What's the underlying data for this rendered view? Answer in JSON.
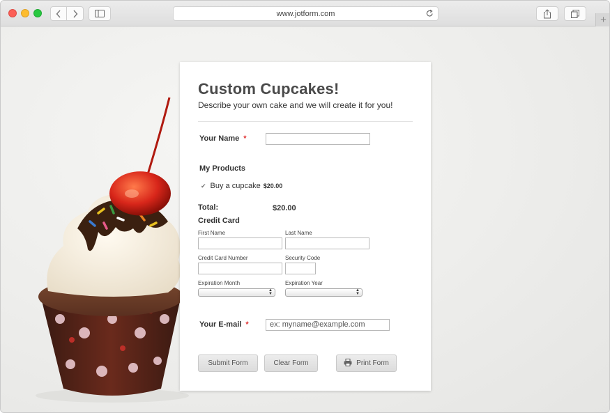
{
  "browser": {
    "url": "www.jotform.com",
    "new_tab_glyph": "+"
  },
  "form": {
    "title": "Custom Cupcakes!",
    "subtitle": "Describe your own cake and we will create it for you!",
    "name_label": "Your Name",
    "name_required": "*",
    "name_value": "",
    "products_label": "My Products",
    "product_item": "Buy a cupcake",
    "product_price": "$20.00",
    "product_checked": true,
    "total_label": "Total:",
    "total_value": "$20.00",
    "credit_card_label": "Credit Card",
    "first_name_label": "First Name",
    "last_name_label": "Last Name",
    "cc_number_label": "Credit Card Number",
    "security_code_label": "Security Code",
    "exp_month_label": "Expiration Month",
    "exp_year_label": "Expiration Year",
    "exp_month_value": "",
    "exp_year_value": "",
    "email_label": "Your E-mail",
    "email_required": "*",
    "email_placeholder": "ex: myname@example.com",
    "submit_label": "Submit Form",
    "clear_label": "Clear Form",
    "print_label": "Print Form"
  },
  "colors": {
    "required": "#e03333",
    "close": "#fc5f57",
    "minimize": "#fdbc2e",
    "maximize": "#28c840"
  },
  "icons": [
    "back-icon",
    "forward-icon",
    "sidebar-icon",
    "reload-icon",
    "share-icon",
    "tabs-icon",
    "checkbox-icon",
    "printer-icon"
  ]
}
